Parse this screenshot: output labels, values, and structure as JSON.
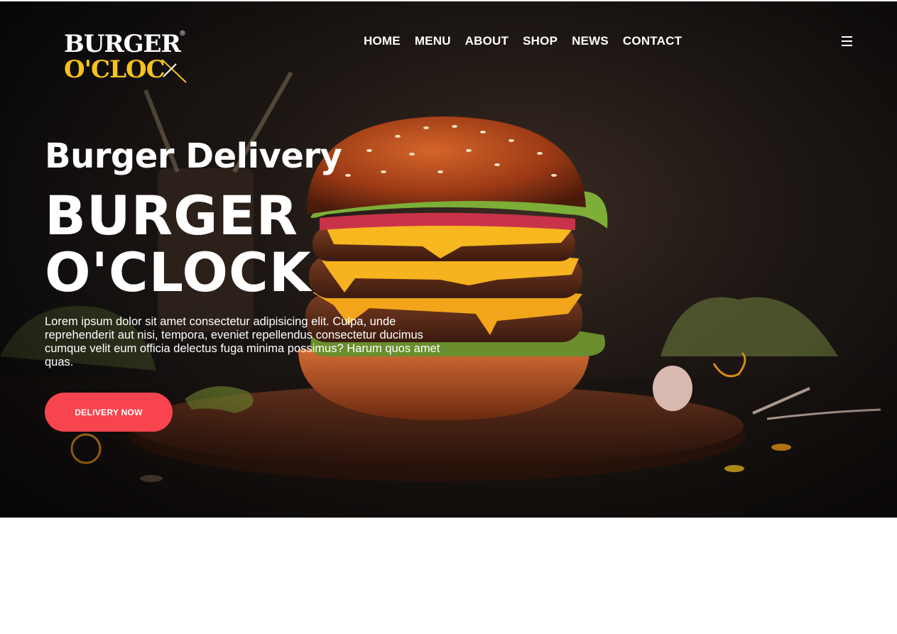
{
  "brand": {
    "logo_line1": "BURGER",
    "logo_line2": "O'CLOC",
    "logo_mark": "®",
    "accent_color": "#f6c21c"
  },
  "nav": {
    "items": [
      {
        "label": "HOME"
      },
      {
        "label": "MENU"
      },
      {
        "label": "ABOUT"
      },
      {
        "label": "SHOP"
      },
      {
        "label": "NEWS"
      },
      {
        "label": "CONTACT"
      }
    ],
    "menu_icon": "hamburger-menu-icon"
  },
  "hero": {
    "eyebrow": "Burger Delivery",
    "title_line1": "BURGER",
    "title_line2": "O'CLOCK",
    "description": "Lorem ipsum dolor sit amet consectetur adipisicing elit. Culpa, unde reprehenderit aut nisi, tempora, eveniet repellendus consectetur ducimus cumque velit eum officia delectus fuga minima possimus? Harum quos amet quas.",
    "cta_label": "DELIVERY NOW",
    "cta_color": "#f8444f",
    "background_image": "burger-on-wooden-board-photo"
  }
}
